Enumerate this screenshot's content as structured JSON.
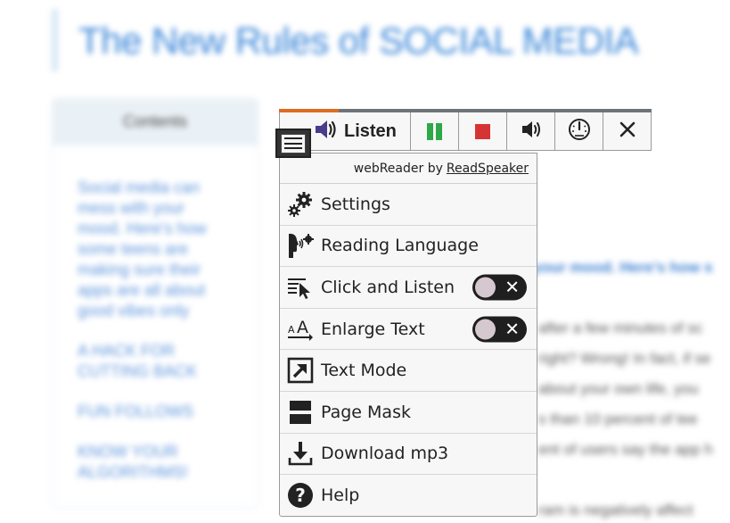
{
  "page": {
    "title": "The New Rules of SOCIAL MEDIA",
    "toc_heading": "Contents",
    "toc_links": [
      "Social media can mess with your mood. Here's how some teens are making sure their apps are all about good vibes only",
      "A HACK FOR CUTTING BACK",
      "FUN FOLLOWS",
      "KNOW YOUR ALGORITHMS!"
    ],
    "article_subhead": "your mood. Here's how s",
    "article_lines": [
      "after a few minutes of sc",
      "right? Wrong! In fact, if se",
      "about your own life, you",
      "s than 10 percent of tee",
      "ent of users say the app h",
      "ram is negatively affect"
    ]
  },
  "player": {
    "listen_label": "Listen",
    "progress_fraction": 0.16,
    "buttons": [
      "pause",
      "stop",
      "volume",
      "speed",
      "close"
    ]
  },
  "menu": {
    "credit_prefix": "webReader by",
    "credit_link": "ReadSpeaker",
    "items": [
      {
        "label": "Settings",
        "icon": "gears-icon"
      },
      {
        "label": "Reading Language",
        "icon": "speaking-head-icon"
      },
      {
        "label": "Click and Listen",
        "icon": "click-pointer-icon",
        "toggle": "off"
      },
      {
        "label": "Enlarge Text",
        "icon": "enlarge-text-icon",
        "toggle": "off"
      },
      {
        "label": "Text Mode",
        "icon": "external-arrow-icon"
      },
      {
        "label": "Page Mask",
        "icon": "page-mask-icon"
      },
      {
        "label": "Download mp3",
        "icon": "download-icon"
      },
      {
        "label": "Help",
        "icon": "help-icon"
      }
    ]
  },
  "colors": {
    "progress": "#e06b22",
    "pause": "#2fa84a",
    "stop": "#d63434",
    "toggle_off": "#1f1f1f"
  }
}
